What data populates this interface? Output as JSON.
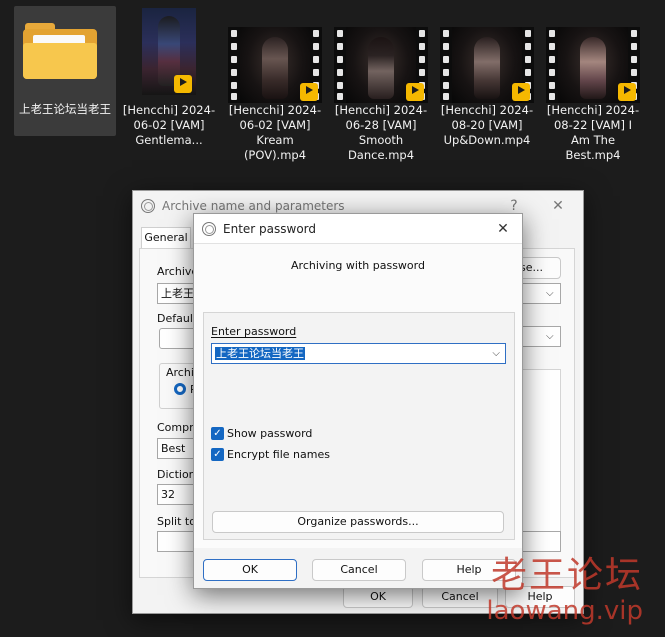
{
  "desktop": {
    "items": [
      {
        "kind": "folder",
        "name": "上老王论坛当老王"
      },
      {
        "kind": "video",
        "name": "[Hencchi] 2024-06-02 [VAM] Gentlema..."
      },
      {
        "kind": "video",
        "name": "[Hencchi] 2024-06-02 [VAM] Kream (POV).mp4"
      },
      {
        "kind": "video",
        "name": "[Hencchi] 2024-06-28 [VAM] Smooth Dance.mp4"
      },
      {
        "kind": "video",
        "name": "[Hencchi] 2024-08-20 [VAM] Up&Down.mp4"
      },
      {
        "kind": "video",
        "name": "[Hencchi] 2024-08-22 [VAM] I Am The Best.mp4"
      }
    ],
    "badge_label": "Player"
  },
  "archive_dialog": {
    "title": "Archive name and parameters",
    "help_glyph": "?",
    "close_glyph": "✕",
    "tab_general": "General",
    "archive_label": "Archive",
    "archive_value": "上老王",
    "browse_label": "se...",
    "default_label": "Default",
    "archive_format_label": "Archiv",
    "radio_label": "R",
    "compression_label": "Compre",
    "compression_value": "Best",
    "dictionary_label": "Dictiona",
    "dictionary_value": "32",
    "split_label": "Split to",
    "ok": "OK",
    "cancel": "Cancel",
    "help": "Help"
  },
  "password_dialog": {
    "title": "Enter password",
    "close_glyph": "✕",
    "heading": "Archiving with password",
    "enter_password_label": "Enter password",
    "password_value": "上老王论坛当老王",
    "show_password_label": "Show password",
    "show_password_checked": true,
    "encrypt_names_label": "Encrypt file names",
    "encrypt_names_checked": true,
    "organize_label": "Organize passwords...",
    "ok": "OK",
    "cancel": "Cancel",
    "help": "Help"
  },
  "watermark": {
    "line1": "老王论坛",
    "line2": "laowang.vip"
  }
}
